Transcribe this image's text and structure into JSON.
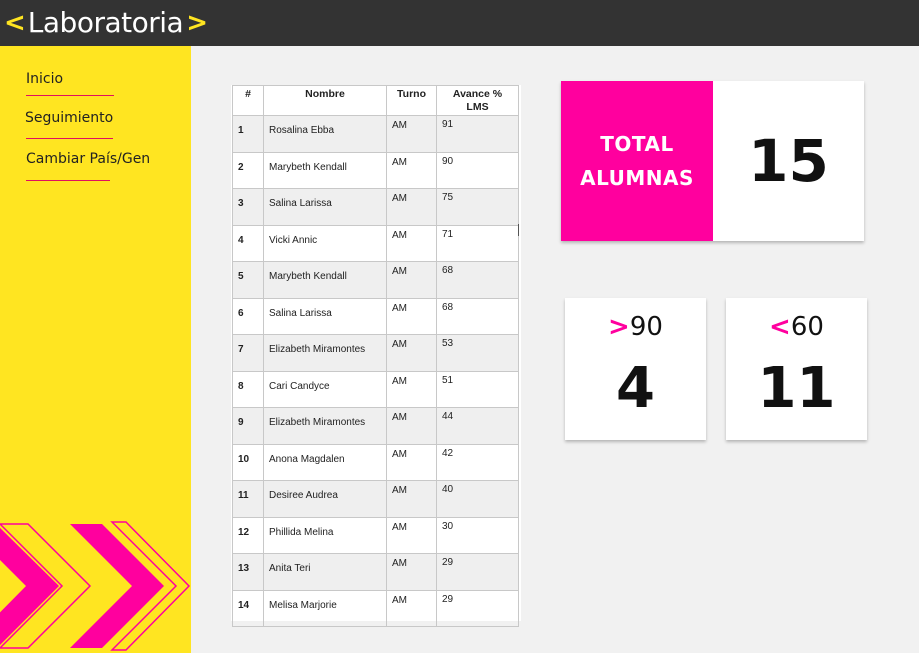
{
  "header": {
    "logo_left": "<",
    "logo_text": "Laboratoria",
    "logo_right": ">",
    "background": "#333333",
    "accent": "#ffe521"
  },
  "sidebar": {
    "background": "#ffe521",
    "items": [
      {
        "label": "Inicio"
      },
      {
        "label": "Seguimiento"
      },
      {
        "label": "Cambiar País/Gen"
      }
    ]
  },
  "table": {
    "headers": [
      "#",
      "Nombre",
      "Turno",
      "Avance %\nLMS"
    ],
    "rows": [
      {
        "n": "1",
        "name": "Rosalina Ebba",
        "turn": "AM",
        "adv": "91"
      },
      {
        "n": "2",
        "name": "Marybeth Kendall",
        "turn": "AM",
        "adv": "90"
      },
      {
        "n": "3",
        "name": "Salina Larissa",
        "turn": "AM",
        "adv": "75"
      },
      {
        "n": "4",
        "name": "Vicki Annic",
        "turn": "AM",
        "adv": "71"
      },
      {
        "n": "5",
        "name": "Marybeth Kendall",
        "turn": "AM",
        "adv": "68"
      },
      {
        "n": "6",
        "name": "Salina Larissa",
        "turn": "AM",
        "adv": "68"
      },
      {
        "n": "7",
        "name": "Elizabeth Miramontes",
        "turn": "AM",
        "adv": "53"
      },
      {
        "n": "8",
        "name": "Cari Candyce",
        "turn": "AM",
        "adv": "51"
      },
      {
        "n": "9",
        "name": "Elizabeth Miramontes",
        "turn": "AM",
        "adv": "44"
      },
      {
        "n": "10",
        "name": "Anona Magdalen",
        "turn": "AM",
        "adv": "42"
      },
      {
        "n": "11",
        "name": "Desiree Audrea",
        "turn": "AM",
        "adv": "40"
      },
      {
        "n": "12",
        "name": "Phillida Melina",
        "turn": "AM",
        "adv": "30"
      },
      {
        "n": "13",
        "name": "Anita Teri",
        "turn": "AM",
        "adv": "29"
      },
      {
        "n": "14",
        "name": "Melisa Marjorie",
        "turn": "AM",
        "adv": "29"
      }
    ]
  },
  "summary": {
    "total_line1": "TOTAL",
    "total_line2": "ALUMNAS",
    "total_value": "15",
    "above": {
      "symbol": ">",
      "threshold": "90",
      "value": "4"
    },
    "below": {
      "symbol": "<",
      "threshold": "60",
      "value": "11"
    },
    "accent": "#ff009e"
  }
}
